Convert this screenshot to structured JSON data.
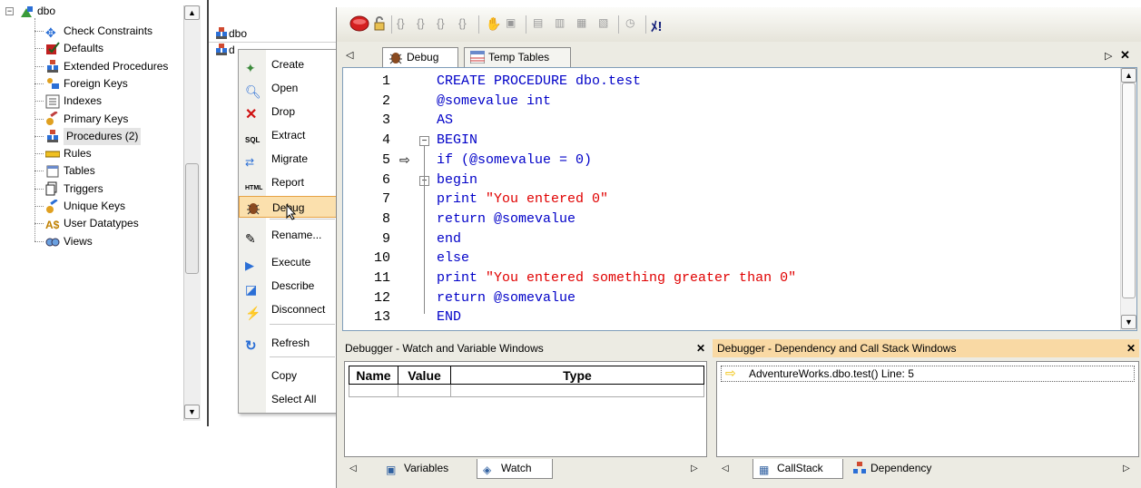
{
  "tree": {
    "root_label": "dbo",
    "items": [
      {
        "label": "Check Constraints",
        "icon": "check-constraints-icon"
      },
      {
        "label": "Defaults",
        "icon": "defaults-icon"
      },
      {
        "label": "Extended Procedures",
        "icon": "extended-procedures-icon"
      },
      {
        "label": "Foreign Keys",
        "icon": "foreign-keys-icon"
      },
      {
        "label": "Indexes",
        "icon": "indexes-icon"
      },
      {
        "label": "Primary Keys",
        "icon": "primary-keys-icon"
      },
      {
        "label": "Procedures (2)",
        "icon": "procedures-icon"
      },
      {
        "label": "Rules",
        "icon": "rules-icon"
      },
      {
        "label": "Tables",
        "icon": "tables-icon"
      },
      {
        "label": "Triggers",
        "icon": "triggers-icon"
      },
      {
        "label": "Unique Keys",
        "icon": "unique-keys-icon"
      },
      {
        "label": "User Datatypes",
        "icon": "user-datatypes-icon"
      },
      {
        "label": "Views",
        "icon": "views-icon"
      }
    ]
  },
  "proc_list": {
    "items": [
      "dbo",
      "d"
    ]
  },
  "context_menu": {
    "items": [
      {
        "label": "Create",
        "icon": "create-icon"
      },
      {
        "label": "Open",
        "icon": "open-icon"
      },
      {
        "label": "Drop",
        "icon": "drop-icon"
      },
      {
        "label": "Extract",
        "icon": "extract-sql-icon"
      },
      {
        "label": "Migrate",
        "icon": "migrate-icon"
      },
      {
        "label": "Report",
        "icon": "report-html-icon"
      },
      {
        "label": "Debug",
        "icon": "debug-bug-icon"
      },
      {
        "label": "Rename...",
        "icon": "rename-pencil-icon"
      },
      {
        "label": "Execute",
        "icon": "execute-icon"
      },
      {
        "label": "Describe",
        "icon": "describe-icon"
      },
      {
        "label": "Disconnect",
        "icon": "disconnect-icon"
      },
      {
        "label": "Refresh",
        "icon": "refresh-icon"
      },
      {
        "label": "Copy",
        "icon": ""
      },
      {
        "label": "Select All",
        "icon": ""
      }
    ],
    "highlighted": "Debug"
  },
  "tabs": {
    "debug_label": "Debug",
    "temp_tables_label": "Temp Tables"
  },
  "editor": {
    "lines": [
      {
        "num": "1",
        "text": "CREATE PROCEDURE dbo.test",
        "color": "blue"
      },
      {
        "num": "2",
        "text": "@somevalue int",
        "color": "blue"
      },
      {
        "num": "3",
        "text": "AS",
        "color": "blue"
      },
      {
        "num": "4",
        "text": "BEGIN",
        "color": "blue"
      },
      {
        "num": "5",
        "text": "if (@somevalue = 0)",
        "color": "blue"
      },
      {
        "num": "6",
        "text": "begin",
        "color": "blue"
      },
      {
        "num": "7",
        "pre": "print ",
        "str": "\"You entered 0\""
      },
      {
        "num": "8",
        "text": "return @somevalue",
        "color": "blue"
      },
      {
        "num": "9",
        "text": "end",
        "color": "blue"
      },
      {
        "num": "10",
        "text": "else",
        "color": "blue"
      },
      {
        "num": "11",
        "pre": "print ",
        "str": "\"You entered something greater than 0\""
      },
      {
        "num": "12",
        "text": "return @somevalue",
        "color": "blue"
      },
      {
        "num": "13",
        "text": "END",
        "color": "blue"
      }
    ],
    "current_line": "5"
  },
  "watch_panel": {
    "title": "Debugger  - Watch and Variable Windows",
    "columns": [
      "Name",
      "Value",
      "Type"
    ],
    "tabs": [
      "Variables",
      "Watch"
    ]
  },
  "callstack_panel": {
    "title": "Debugger - Dependency and Call Stack Windows",
    "entries": [
      "AdventureWorks.dbo.test() Line: 5"
    ],
    "tabs": [
      "CallStack",
      "Dependency"
    ]
  },
  "colors": {
    "keyword": "#0000c8",
    "string": "#e00000",
    "highlight_bg": "#fbe0ad",
    "active_panel_header": "#f9d9a4"
  }
}
